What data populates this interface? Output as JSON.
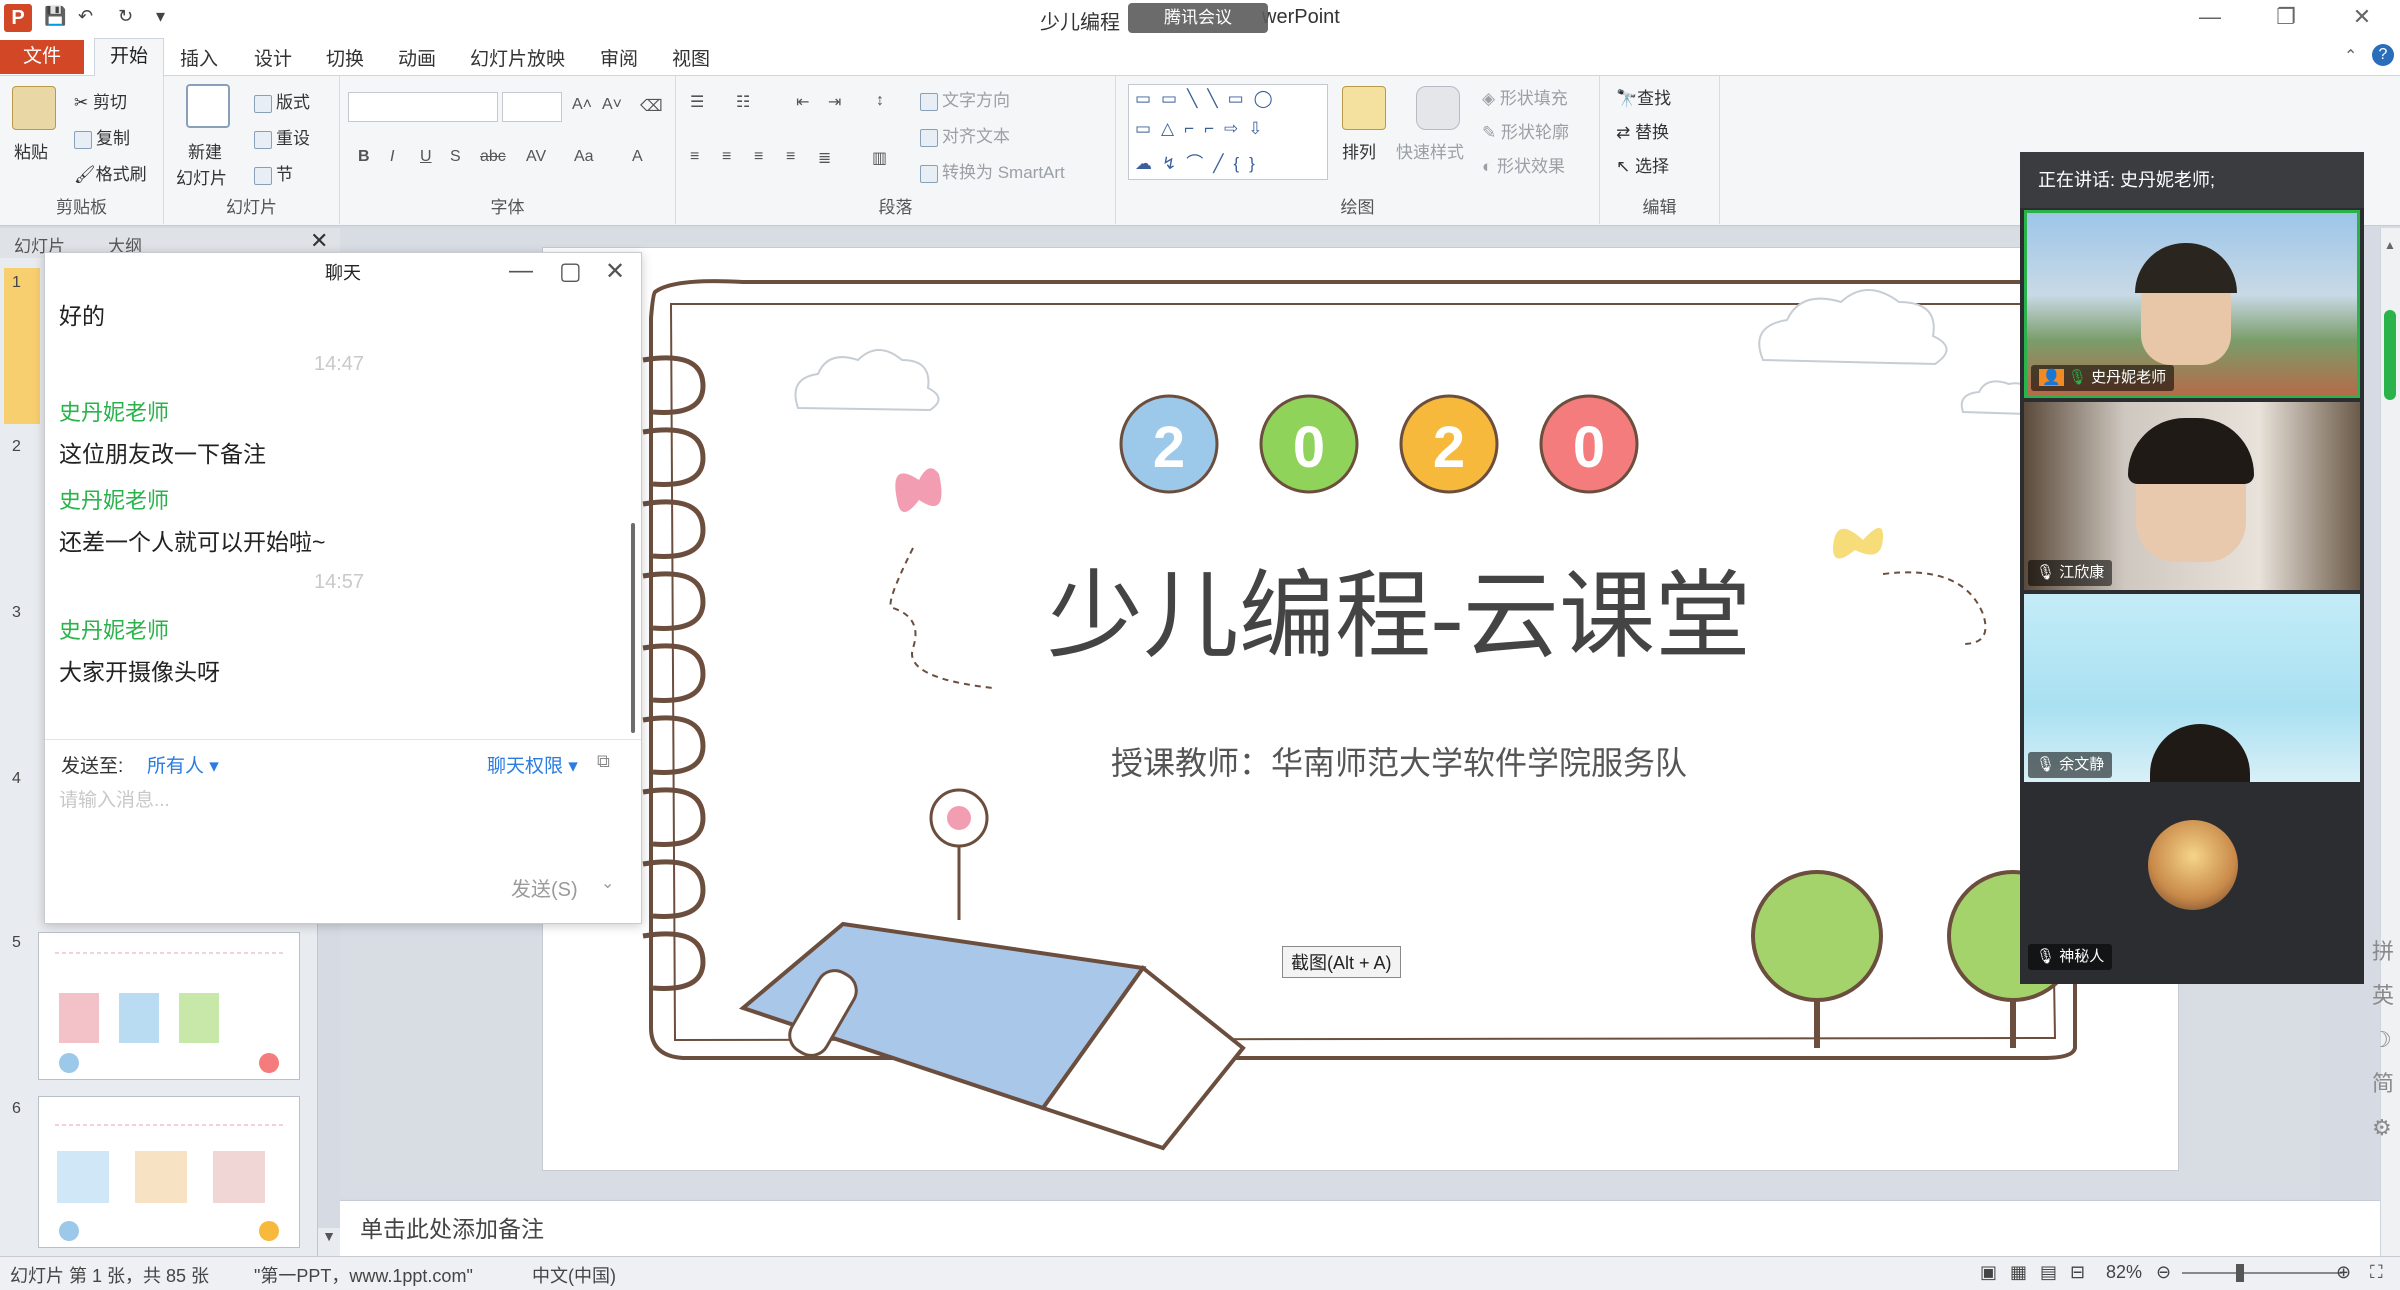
{
  "titlebar": {
    "title": "少儿编程",
    "title_suffix": "werPoint",
    "meeting_pill": "腾讯会议",
    "app_icon_letter": "P"
  },
  "tabs": [
    "文件",
    "开始",
    "插入",
    "设计",
    "切换",
    "动画",
    "幻灯片放映",
    "审阅",
    "视图"
  ],
  "ribbon": {
    "clipboard": {
      "paste": "粘贴",
      "cut": "剪切",
      "copy": "复制",
      "format_painter": "格式刷",
      "label": "剪贴板"
    },
    "slides": {
      "new_slide_1": "新建",
      "new_slide_2": "幻灯片",
      "layout": "版式",
      "reset": "重设",
      "section": "节",
      "label": "幻灯片"
    },
    "font": {
      "label": "字体"
    },
    "paragraph": {
      "text_direction": "文字方向",
      "align_text": "对齐文本",
      "smartart": "转换为 SmartArt",
      "label": "段落"
    },
    "drawing": {
      "arrange": "排列",
      "quick_styles": "快速样式",
      "shape_fill": "形状填充",
      "shape_outline": "形状轮廓",
      "shape_effects": "形状效果",
      "label": "绘图"
    },
    "editing": {
      "find": "查找",
      "replace": "替换",
      "select": "选择",
      "label": "编辑"
    }
  },
  "left_pane": {
    "tabs": [
      "幻灯片",
      "大纲"
    ],
    "slide_numbers": [
      "1",
      "2",
      "3",
      "4",
      "5",
      "6"
    ]
  },
  "chat": {
    "title": "聊天",
    "messages": [
      {
        "type": "text",
        "text": "好的"
      },
      {
        "type": "time",
        "text": "14:47"
      },
      {
        "type": "sender",
        "text": "史丹妮老师"
      },
      {
        "type": "text",
        "text": "这位朋友改一下备注"
      },
      {
        "type": "sender",
        "text": "史丹妮老师"
      },
      {
        "type": "text",
        "text": "还差一个人就可以开始啦~"
      },
      {
        "type": "time",
        "text": "14:57"
      },
      {
        "type": "sender",
        "text": "史丹妮老师"
      },
      {
        "type": "text",
        "text": "大家开摄像头呀"
      }
    ],
    "send_to_label": "发送至:",
    "send_to_value": "所有人",
    "permissions": "聊天权限",
    "input_placeholder": "请输入消息...",
    "send_button": "发送(S)"
  },
  "slide": {
    "year_digits": [
      "2",
      "0",
      "2",
      "0"
    ],
    "balloon_colors": [
      "#9cc8ea",
      "#8fd35a",
      "#f6b93b",
      "#f47c7c"
    ],
    "title": "少儿编程-云课堂",
    "subtitle": "授课教师：华南师范大学软件学院服务队",
    "screenshot_tooltip": "截图(Alt + A)"
  },
  "notes": {
    "placeholder": "单击此处添加备注"
  },
  "status": {
    "slide_info": "幻灯片 第 1 张，共 85 张",
    "theme": "\"第一PPT，www.1ppt.com\"",
    "language": "中文(中国)",
    "zoom": "82%"
  },
  "video": {
    "speaking_label": "正在讲话: 史丹妮老师;",
    "participants": [
      {
        "name": "史丹妮老师"
      },
      {
        "name": "江欣康"
      },
      {
        "name": "余文静"
      },
      {
        "name": "神秘人"
      }
    ]
  },
  "ime": {
    "chars": [
      "拼",
      "英",
      "简"
    ]
  }
}
